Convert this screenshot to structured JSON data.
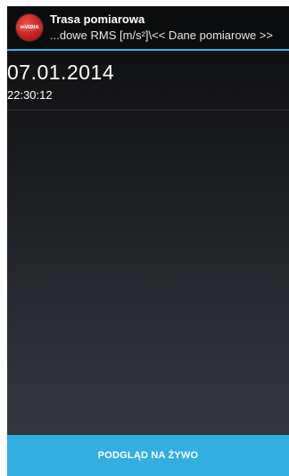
{
  "action_bar": {
    "title": "Trasa pomiarowa",
    "subtitle": "...dowe RMS [m/s²]\\<< Dane pomiarowe >>",
    "icon": "app-logo-icon",
    "icon_text": "mVIDIA",
    "accent_color": "#33b5e5"
  },
  "list": {
    "items": [
      {
        "date": "07.01.2014",
        "time": "22:30:12"
      }
    ]
  },
  "footer": {
    "live_button_label": "PODGLĄD NA ŻYWO",
    "button_color": "#33aee0"
  }
}
